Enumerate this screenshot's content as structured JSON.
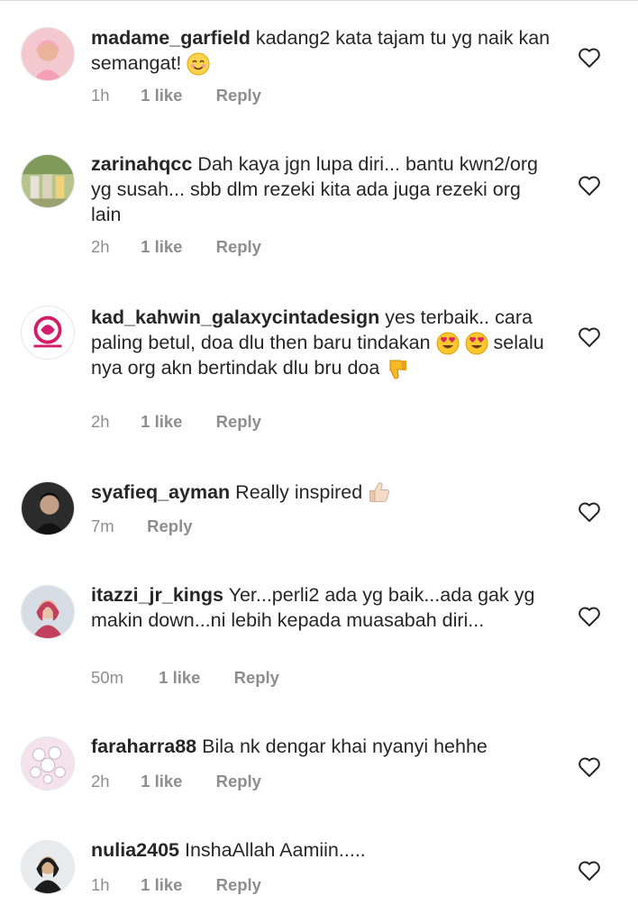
{
  "comments": [
    {
      "username": "madame_garfield",
      "text_parts": [
        "kadang2 kata tajam tu yg naik kan semangat!"
      ],
      "emoji_after": "smiling-face-emoji",
      "time": "1h",
      "likes": "1 like",
      "reply": "Reply"
    },
    {
      "username": "zarinahqcc",
      "text_parts": [
        "Dah kaya jgn lupa diri... bantu kwn2/org yg susah... sbb dlm rezeki kita ada juga rezeki org lain"
      ],
      "time": "2h",
      "likes": "1 like",
      "reply": "Reply"
    },
    {
      "username": "kad_kahwin_galaxycintadesign",
      "text_parts": [
        "yes terbaik.. cara paling betul, doa dlu then baru tindakan",
        "selalu nya org akn bertindak dlu bru doa"
      ],
      "emojis": [
        "heart-eyes-emoji",
        "heart-eyes-emoji",
        "thumbs-down-emoji"
      ],
      "time": "2h",
      "likes": "1 like",
      "reply": "Reply"
    },
    {
      "username": "syafieq_ayman",
      "text_parts": [
        "Really inspired"
      ],
      "emoji_after": "thumbs-up-emoji",
      "time": "7m",
      "reply": "Reply"
    },
    {
      "username": "itazzi_jr_kings",
      "text_parts": [
        "Yer...perli2 ada yg baik...ada gak yg makin down...ni lebih kepada muasabah diri..."
      ],
      "time": "50m",
      "likes": "1 like",
      "reply": "Reply"
    },
    {
      "username": "faraharra88",
      "text_parts": [
        "Bila nk dengar khai nyanyi hehhe"
      ],
      "time": "2h",
      "likes": "1 like",
      "reply": "Reply"
    },
    {
      "username": "nulia2405",
      "text_parts": [
        "InshaAllah Aamiin....."
      ],
      "time": "1h",
      "likes": "1 like",
      "reply": "Reply"
    }
  ],
  "icons": {
    "like": "heart-outline-icon"
  },
  "colors": {
    "text": "#262626",
    "meta": "#8e8e8e",
    "divider": "#dbdbdb"
  }
}
